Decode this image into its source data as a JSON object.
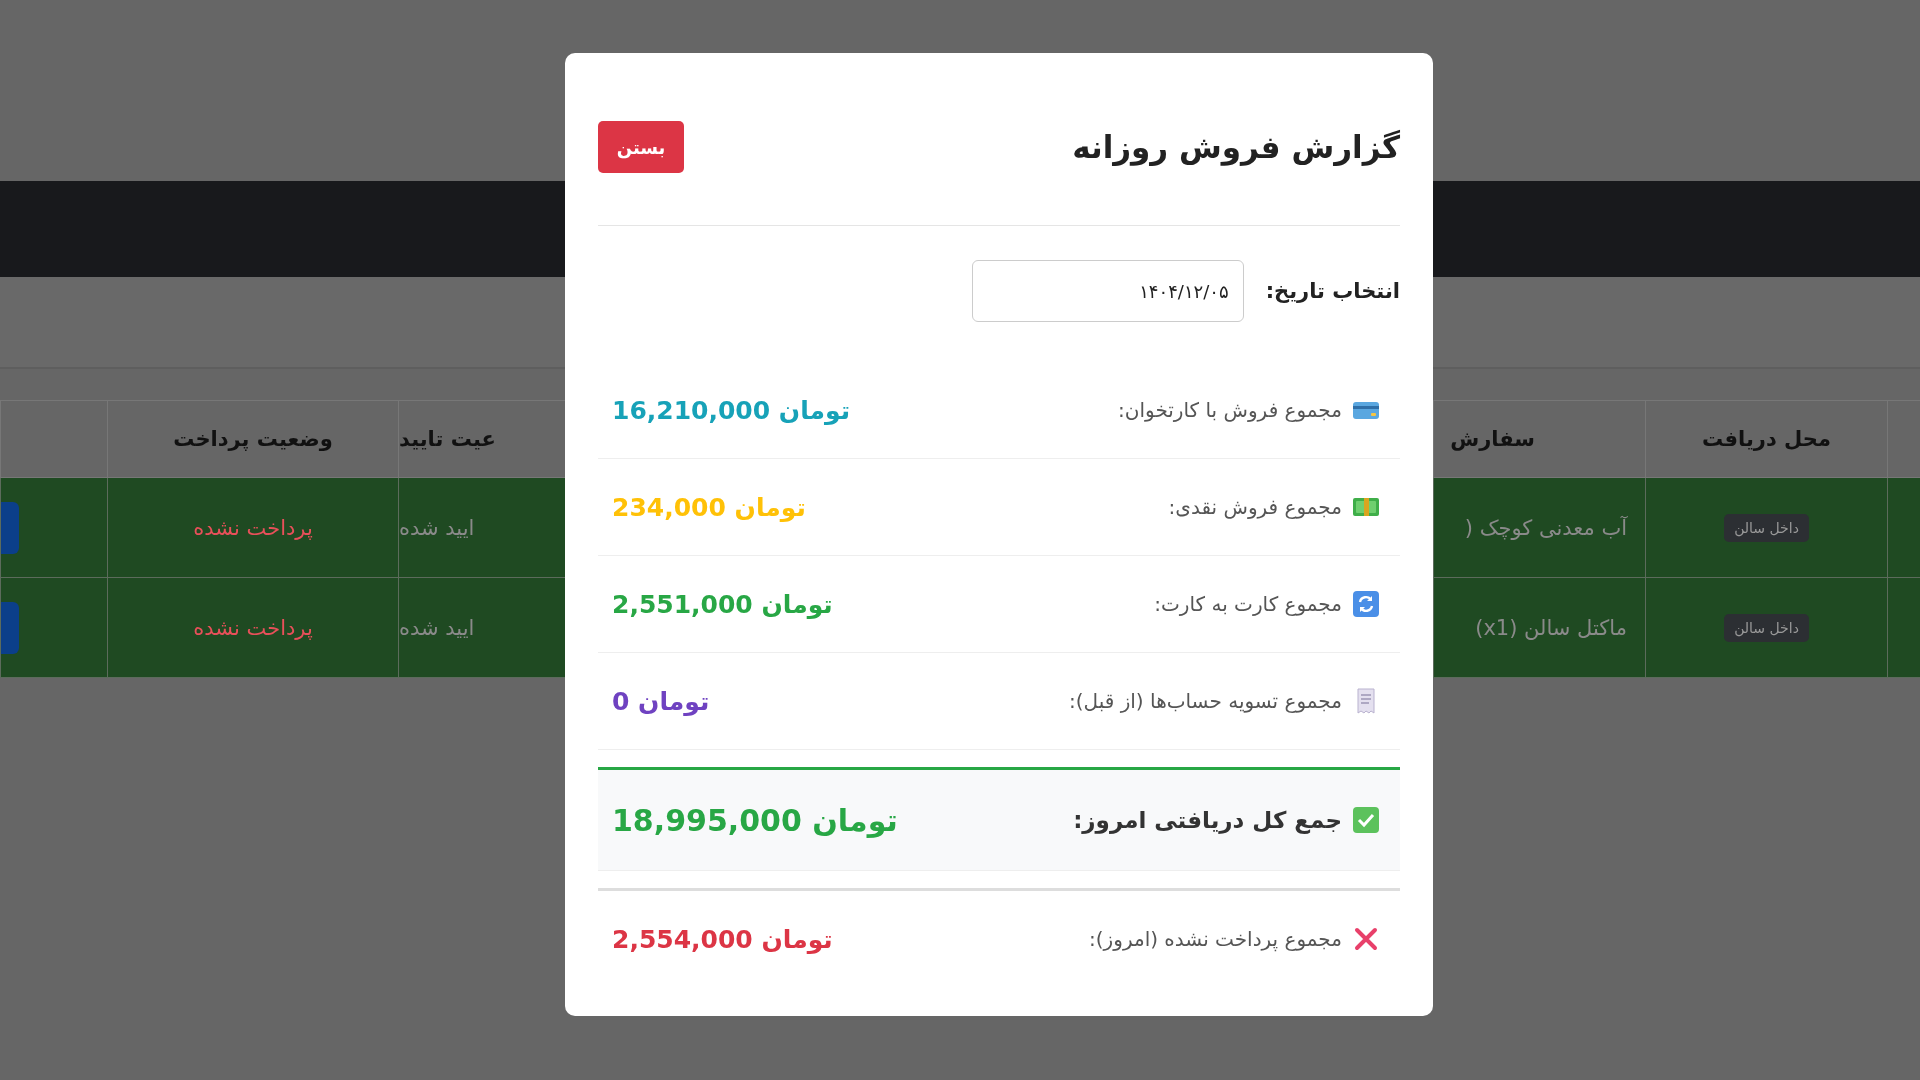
{
  "background": {
    "table": {
      "columns": [
        "محل دریافت",
        "سفارش",
        "عیت تایید",
        "وضعیت پرداخت"
      ],
      "rows": [
        {
          "payment": "پرداخت نشده",
          "confirmation": "ایید شده",
          "order": "آب معدنی کوچک (",
          "pickup": "داخل سالن"
        },
        {
          "payment": "پرداخت نشده",
          "confirmation": "ایید شده",
          "order": "ماکتل سالن (x1)",
          "pickup": "داخل سالن"
        }
      ]
    }
  },
  "modal": {
    "title": "گزارش فروش روزانه",
    "close_button": "بستن",
    "date_field": {
      "label": "انتخاب تاریخ:",
      "value": "۱۴۰۴/۱۲/۰۵"
    },
    "rows": [
      {
        "kind": "card",
        "label": "مجموع فروش با کارتخوان:",
        "amount": "16,210,000 تومان",
        "color": "#17a2b8"
      },
      {
        "kind": "cash",
        "label": "مجموع فروش نقدی:",
        "amount": "234,000 تومان",
        "color": "#ffc107"
      },
      {
        "kind": "transfer",
        "label": "مجموع کارت به کارت:",
        "amount": "2,551,000 تومان",
        "color": "#28a745"
      },
      {
        "kind": "receipt",
        "label": "مجموع تسویه حساب‌ها (از قبل):",
        "amount": "0 تومان",
        "color": "#6f42c1"
      }
    ],
    "total": {
      "label": "جمع کل دریافتی امروز:",
      "amount": "18,995,000 تومان"
    },
    "unpaid": {
      "label": "مجموع پرداخت نشده (امروز):",
      "amount": "2,554,000 تومان"
    }
  }
}
